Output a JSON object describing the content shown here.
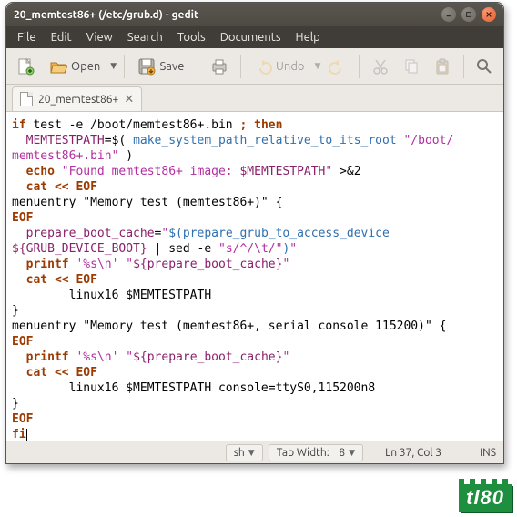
{
  "window": {
    "title": "20_memtest86+ (/etc/grub.d) - gedit"
  },
  "menubar": {
    "items": [
      "File",
      "Edit",
      "View",
      "Search",
      "Tools",
      "Documents",
      "Help"
    ]
  },
  "toolbar": {
    "new": "new-doc",
    "open_label": "Open",
    "save_label": "Save",
    "undo_label": "Undo"
  },
  "tab": {
    "label": "20_memtest86+",
    "close": "✕"
  },
  "code": {
    "l1a": "if",
    "l1b": " test -e /boot/memtest86+.bin ",
    "l1c": ";",
    "l1d": " then",
    "l2a": "  ",
    "l2b": "MEMTESTPATH",
    "l2c": "=$( ",
    "l2d": "make_system_path_relative_to_its_root",
    "l2e": " ",
    "l2f": "\"/boot/",
    "l3a": "memtest86+.bin\"",
    "l3b": " )",
    "l4a": "  ",
    "l4b": "echo",
    "l4c": " ",
    "l4d": "\"Found memtest86+ image: ",
    "l4e": "$MEMTESTPATH",
    "l4f": "\"",
    "l4g": " >&2",
    "l5a": "  ",
    "l5b": "cat",
    "l5c": " << ",
    "l5d": "EOF",
    "l6": "menuentry \"Memory test (memtest86+)\" {",
    "l7": "EOF",
    "l8a": "  ",
    "l8b": "prepare_boot_cache",
    "l8c": "=",
    "l8d": "\"",
    "l8e": "$(",
    "l8f": "prepare_grub_to_access_device",
    "l9a": "${GRUB_DEVICE_BOOT}",
    "l9b": " | sed -e ",
    "l9c": "\"s/^/\\t/\"",
    "l9d": ")",
    "l9e": "\"",
    "l10a": "  ",
    "l10b": "printf",
    "l10c": " ",
    "l10d": "'%s\\n'",
    "l10e": " ",
    "l10f": "\"",
    "l10g": "${prepare_boot_cache}",
    "l10h": "\"",
    "l11a": "  ",
    "l11b": "cat",
    "l11c": " << ",
    "l11d": "EOF",
    "l12": "        linux16 $MEMTESTPATH",
    "l13": "}",
    "l14": "menuentry \"Memory test (memtest86+, serial console 115200)\" {",
    "l15": "EOF",
    "l16a": "  ",
    "l16b": "printf",
    "l16c": " ",
    "l16d": "'%s\\n'",
    "l16e": " ",
    "l16f": "\"",
    "l16g": "${prepare_boot_cache}",
    "l16h": "\"",
    "l17a": "  ",
    "l17b": "cat",
    "l17c": " << ",
    "l17d": "EOF",
    "l18": "        linux16 $MEMTESTPATH console=ttyS0,115200n8",
    "l19": "}",
    "l20": "EOF",
    "l21": "fi"
  },
  "statusbar": {
    "lang": "sh",
    "tabwidth_label": "Tab Width:",
    "tabwidth_value": "8",
    "position": "Ln 37, Col 3",
    "mode": "INS"
  },
  "watermark": "tl80"
}
